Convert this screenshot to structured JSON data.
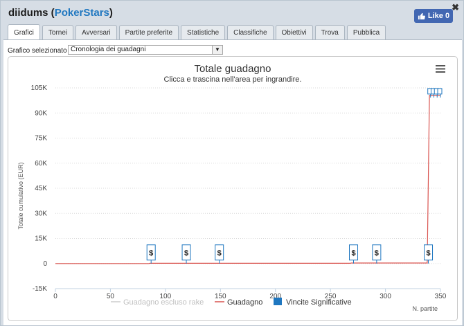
{
  "window": {
    "player": "diidums",
    "site": "PokerStars",
    "paren_open": " (",
    "paren_close": ")",
    "close_glyph": "✖",
    "like_label": "Like 0"
  },
  "tabs": [
    {
      "label": "Grafici",
      "active": true
    },
    {
      "label": "Tornei"
    },
    {
      "label": "Avversari"
    },
    {
      "label": "Partite preferite"
    },
    {
      "label": "Statistiche"
    },
    {
      "label": "Classifiche"
    },
    {
      "label": "Obiettivi"
    },
    {
      "label": "Trova"
    },
    {
      "label": "Pubblica"
    }
  ],
  "selector": {
    "label": "Grafico selezionato",
    "value": "Cronologia dei guadagni"
  },
  "chart_data": {
    "type": "line",
    "title": "Totale guadagno",
    "subtitle": "Clicca e trascina nell'area per ingrandire.",
    "xlabel": "N. partite",
    "ylabel": "Totale cumulativo (EUR)",
    "xlim": [
      0,
      350
    ],
    "ylim": [
      -15000,
      105000
    ],
    "x_ticks": [
      0,
      50,
      100,
      150,
      200,
      250,
      300,
      350
    ],
    "y_ticks": [
      -15000,
      0,
      15000,
      30000,
      45000,
      60000,
      75000,
      90000,
      105000
    ],
    "y_tick_labels": [
      "-15K",
      "0",
      "15K",
      "30K",
      "45K",
      "60K",
      "75K",
      "90K",
      "105K"
    ],
    "series": [
      {
        "name": "Guadagno escluso rake",
        "color": "#cccccc",
        "visible": false
      },
      {
        "name": "Guadagno",
        "color": "#d9534f",
        "x": [
          0,
          85,
          86,
          268,
          269,
          338,
          340,
          342,
          350
        ],
        "y": [
          0,
          0,
          150,
          150,
          300,
          300,
          100500,
          100500,
          100500
        ]
      },
      {
        "name": "Vincite Significative",
        "color": "#1f77c0"
      }
    ],
    "flags": [
      {
        "x": 87,
        "label": "$"
      },
      {
        "x": 119,
        "label": "$"
      },
      {
        "x": 149,
        "label": "$"
      },
      {
        "x": 271,
        "label": "$"
      },
      {
        "x": 292,
        "label": "$"
      },
      {
        "x": 339,
        "label": "$"
      }
    ],
    "top_flags": [
      341,
      344,
      347,
      350
    ],
    "grid": true,
    "legend_position": "bottom"
  }
}
